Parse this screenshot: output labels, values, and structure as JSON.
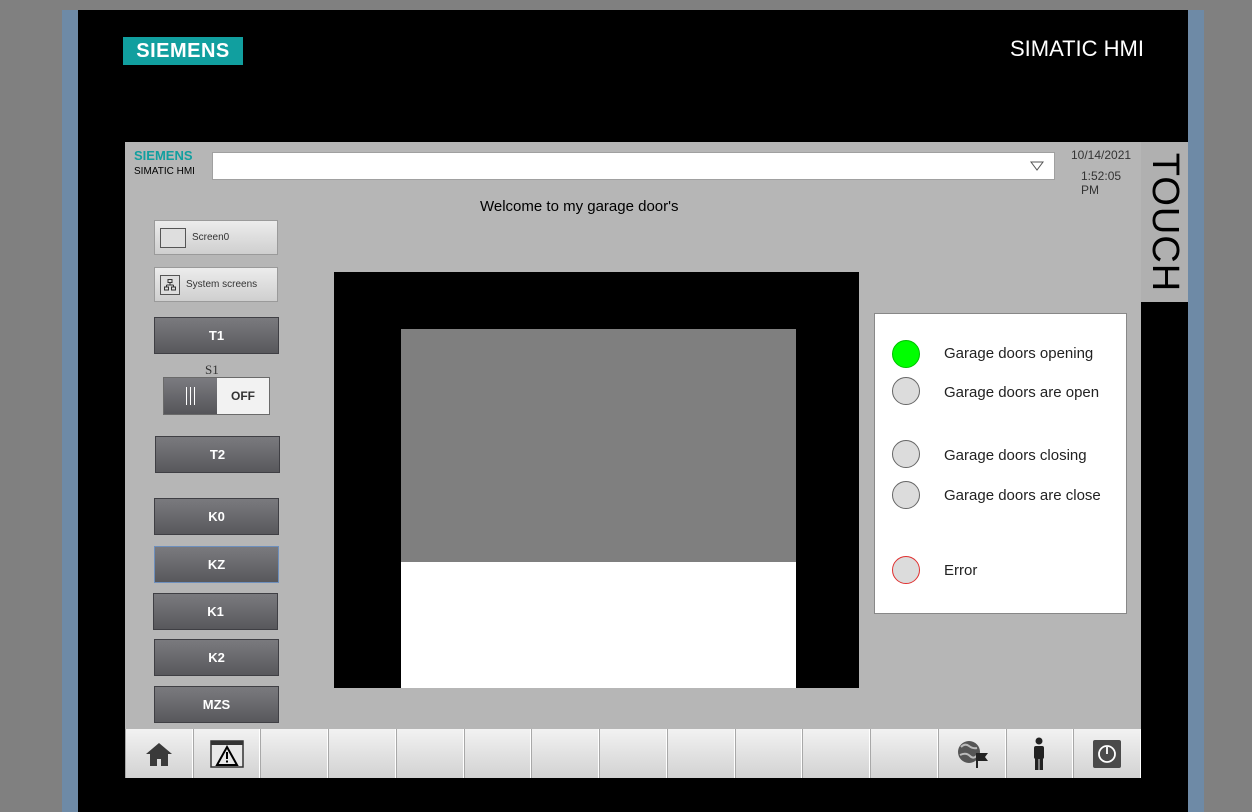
{
  "device": {
    "brand": "SIEMENS",
    "product": "SIMATIC HMI",
    "side_label": "TOUCH"
  },
  "header": {
    "brand": "SIEMENS",
    "product": "SIMATIC HMI",
    "date": "10/14/2021",
    "time": "1:52:05 PM"
  },
  "title": "Welcome to my garage door's",
  "nav": {
    "screen0": "Screen0",
    "system_screens": "System screens"
  },
  "buttons": {
    "t1": "T1",
    "t2": "T2",
    "k0": "K0",
    "kz": "KZ",
    "k1": "K1",
    "k2": "K2",
    "mzs": "MZS"
  },
  "switch_s1": {
    "label": "S1",
    "state": "OFF"
  },
  "door": {
    "closed_fraction": 0.65
  },
  "status": {
    "opening": "Garage doors opening",
    "open": "Garage doors are open",
    "closing": "Garage doors closing",
    "closed": "Garage doors are close",
    "error": "Error"
  },
  "colors": {
    "brand_teal": "#119f9f",
    "lamp_on": "#00ff00",
    "lamp_off": "#dcdcdc",
    "error_ring": "#e03030"
  },
  "function_keys": [
    "home-icon",
    "alarm-icon",
    "",
    "",
    "",
    "",
    "",
    "",
    "",
    "",
    "",
    "",
    "language-icon",
    "user-icon",
    "power-icon"
  ]
}
